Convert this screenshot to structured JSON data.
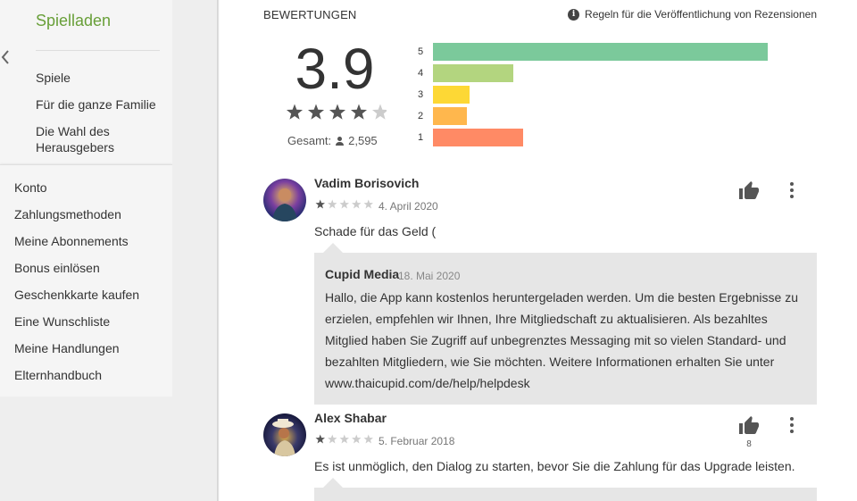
{
  "sidebar": {
    "store_title": "Spielladen",
    "categories": [
      "Spiele",
      "Für die ganze Familie",
      "Die Wahl des Herausgebers"
    ],
    "menu": [
      "Konto",
      "Zahlungsmethoden",
      "Meine Abonnements",
      "Bonus einlösen",
      "Geschenkkarte kaufen",
      "Eine Wunschliste",
      "Meine Handlungen",
      "Elternhandbuch"
    ]
  },
  "ratings": {
    "section_title": "BEWERTUNGEN",
    "policy_link": "Regeln für die Veröffentlichung von Rezensionen",
    "score": "3.9",
    "score_value": 3.9,
    "total_label": "Gesamt:",
    "total_count": "2,595",
    "histogram": [
      {
        "label": "5",
        "fraction": 1.0,
        "color": "#7bc99b"
      },
      {
        "label": "4",
        "fraction": 0.24,
        "color": "#b3d57f"
      },
      {
        "label": "3",
        "fraction": 0.11,
        "color": "#fdd835"
      },
      {
        "label": "2",
        "fraction": 0.1,
        "color": "#ffb74d"
      },
      {
        "label": "1",
        "fraction": 0.27,
        "color": "#ff8a65"
      }
    ]
  },
  "reviews": [
    {
      "author": "Vadim Borisovich",
      "stars": 1,
      "date": "4. April 2020",
      "text": "Schade für das Geld (",
      "likes": "",
      "reply": {
        "author": "Cupid Media",
        "date": "18. Mai 2020",
        "lines": [
          "Hallo, die App kann kostenlos heruntergeladen werden. Um die besten Ergebnisse zu",
          "erzielen, empfehlen wir Ihnen, Ihre Mitgliedschaft zu aktualisieren. Als bezahltes",
          "Mitglied haben Sie Zugriff auf unbegrenztes Messaging mit so vielen Standard- und",
          "bezahlten Mitgliedern, wie Sie möchten. Weitere Informationen erhalten Sie unter",
          "www.thaicupid.com/de/help/helpdesk"
        ]
      }
    },
    {
      "author": "Alex Shabar",
      "stars": 1,
      "date": "5. Februar 2018",
      "text": "Es ist unmöglich, den Dialog zu starten, bevor Sie die Zahlung für das Upgrade leisten.",
      "likes": "8"
    }
  ],
  "icons": {
    "back": "chevron-left-icon",
    "info": "info-icon",
    "person": "person-icon",
    "thumb": "thumb-up-icon",
    "menu": "more-vert-icon",
    "star": "star-icon"
  },
  "colors": {
    "brand_green": "#689f38",
    "star_filled": "#555555",
    "star_empty": "#cccccc",
    "reply_bg": "#e6e6e6"
  }
}
